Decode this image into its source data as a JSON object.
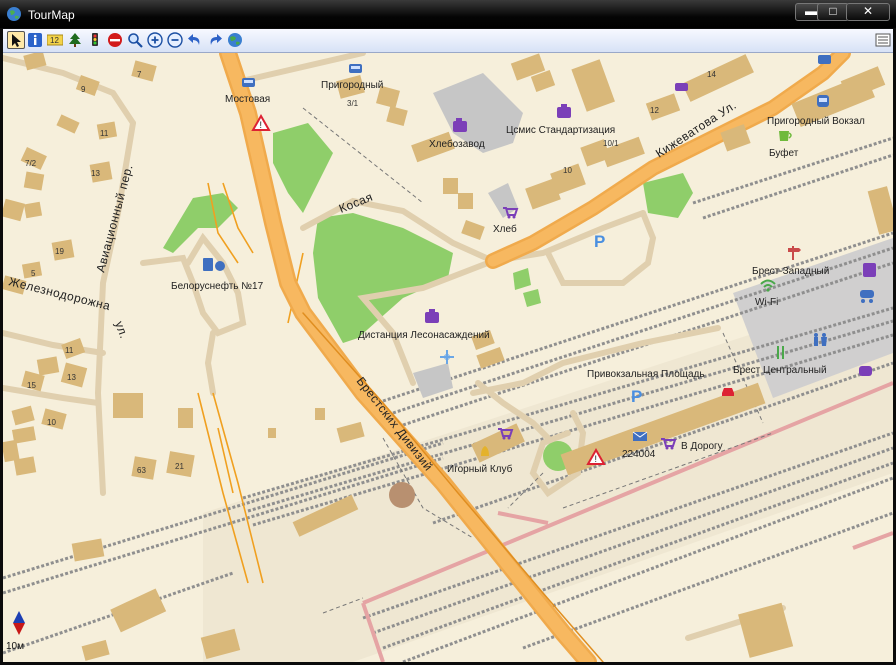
{
  "window": {
    "title": "TourMap"
  },
  "toolbar": {
    "items": [
      "pointer-tool",
      "info-tool",
      "label-tool",
      "trees-tool",
      "traffic-light-tool",
      "stop-tool",
      "zoom-tool",
      "zoom-in-tool",
      "zoom-out-tool",
      "undo-tool",
      "redo-tool",
      "globe-tool",
      "list-tool"
    ],
    "label_tool_text": "12"
  },
  "map": {
    "pois": {
      "mostovaya": "Мостовая",
      "prigorodny": "Пригородный",
      "khlebozavod": "Хлебозавод",
      "tsms": "Цсмис Стандартизация",
      "prigorodny_vokzal": "Пригородный Вокзал",
      "bufet": "Буфет",
      "khleb": "Хлеб",
      "belorusneft": "Белоруснефть №17",
      "distantsiya": "Дистанция Лесонасаждений",
      "brest_zapadny": "Брест-Западный",
      "wifi": "Wi-Fi",
      "brest_tsentralny": "Брест Центральный",
      "privokzalnaya": "Привокзальная Площадь",
      "v_dorogu": "В Дорогу",
      "postcode": "224004",
      "igorny_klub": "Игорный Клуб"
    },
    "streets": {
      "aviatsionny": "Авиационный пер.",
      "zheleznodorozhnaya": "Железнодорожна",
      "zheleznodorozhnaya_suffix": "ул.",
      "kosaya": "Косая",
      "kizhevatova": "Кижеватова Ул.",
      "brestskikh_divizy": "Брестских Дивизий"
    },
    "house_numbers": [
      "7",
      "9",
      "11",
      "13",
      "7/2",
      "5",
      "19",
      "11",
      "13",
      "15",
      "10",
      "63",
      "21",
      "3/1",
      "10/1",
      "12",
      "14",
      "10"
    ],
    "scale_text": "10м"
  }
}
